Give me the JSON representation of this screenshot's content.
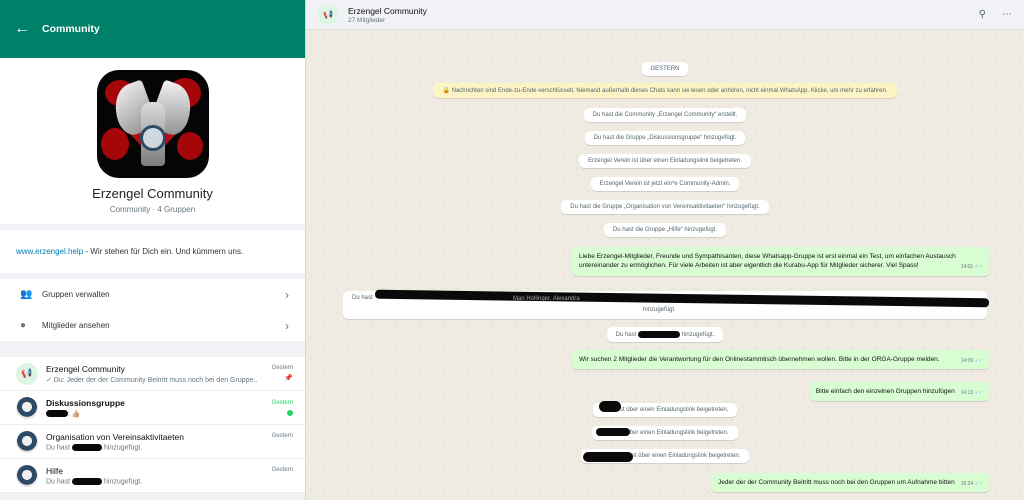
{
  "left": {
    "header_title": "Community",
    "back_icon": "arrow-left-icon",
    "profile": {
      "name": "Erzengel Community",
      "subtitle": "Community · 4 Gruppen"
    },
    "description": {
      "link": "www.erzengel.help",
      "text": " - Wir stehen für Dich ein. Und kümmern uns."
    },
    "actions": [
      {
        "label": "Gruppen verwalten",
        "icon": "group-icon"
      },
      {
        "label": "Mitglieder ansehen",
        "icon": "person-icon"
      }
    ],
    "groups": [
      {
        "name": "Erzengel Community",
        "message": "✓ Du: Jeder der der Community Beitritt muss noch bei den Gruppe...",
        "time": "Gestern",
        "pinned": true
      },
      {
        "name": "Diskussionsgruppe",
        "message": ": 👍🏼",
        "time": "Gestern",
        "unread": true
      },
      {
        "name": "Organisation von Vereinsaktivitaeten",
        "message_prefix": "Du hast",
        "message_suffix": "hinzugefügt.",
        "time": "Gestern"
      },
      {
        "name": "Hilfe",
        "message_prefix": "Du hast",
        "message_suffix": "hinzugefügt.",
        "time": "Gestern"
      }
    ]
  },
  "chat": {
    "title": "Erzengel Community",
    "subtitle": "27 Mitglieder",
    "date_label": "GESTERN",
    "encryption_notice": "🔒 Nachrichten sind Ende-zu-Ende-verschlüsselt. Niemand außerhalb dieses Chats kann sie lesen oder anhören, nicht einmal WhatsApp. Klicke, um mehr zu erfahren.",
    "system": [
      "Du hast die Community „Erzengel Community“ erstellt.",
      "Du hast die Gruppe „Diskussionsgruppe“ hinzugefügt.",
      "Erzengel Verein ist über einen Einladungslink beigetreten.",
      "Erzengel Verein ist jetzt ein*e Community-Admin.",
      "Du hast die Gruppe „Organisation von Vereinsaktivitaeten“ hinzugefügt.",
      "Du hast die Gruppe „Hilfe“ hinzugefügt."
    ],
    "msg1": {
      "text": "Liebe Erzengel-Mitglieder, Freunde und Sympathisanten, diese Whatsapp-Gruppe ist erst einmal ein Test, um einfachen Austausch untereinander zu ermöglichen. Für viele Arbeiten ist aber eigentlich die Kurabu-App für Mitglieder sicherer. Viel Spass!",
      "time": "14:01"
    },
    "added_long": {
      "prefix": "Du hast",
      "visible": "Man Hollinger, Alexandra",
      "suffix": "hinzugefügt."
    },
    "added_short": {
      "prefix": "Du hast",
      "suffix": "hinzugefügt."
    },
    "msg2": {
      "text": "Wir suchen 2 Mitglieder die Verantwortung für den Onlinestammtisch übernehmen wollen. Bitte in der ORGA-Gruppe melden.",
      "time": "14:09"
    },
    "msg3": {
      "text": "Bitte einfach den einzelnen Gruppen hinzufügen",
      "time": "14:13"
    },
    "joins": [
      "ist über einen Einladungslink beigetreten.",
      "über einen Einladungslink beigetreten.",
      "ist über einen Einladungslink beigetreten."
    ],
    "msg4": {
      "text": "Jeder der der Community Beitritt muss noch bei den Gruppen um Aufnahme bitten",
      "time": "16:24"
    }
  },
  "icons": {
    "search": "search-icon",
    "menu": "more-vertical-icon",
    "community": "megaphone-icon",
    "pin": "pin-icon"
  },
  "colors": {
    "header_green": "#008069",
    "outgoing_bubble": "#d9fdd3",
    "encryption_bg": "#fdf4c5",
    "unread_green": "#25d366"
  }
}
